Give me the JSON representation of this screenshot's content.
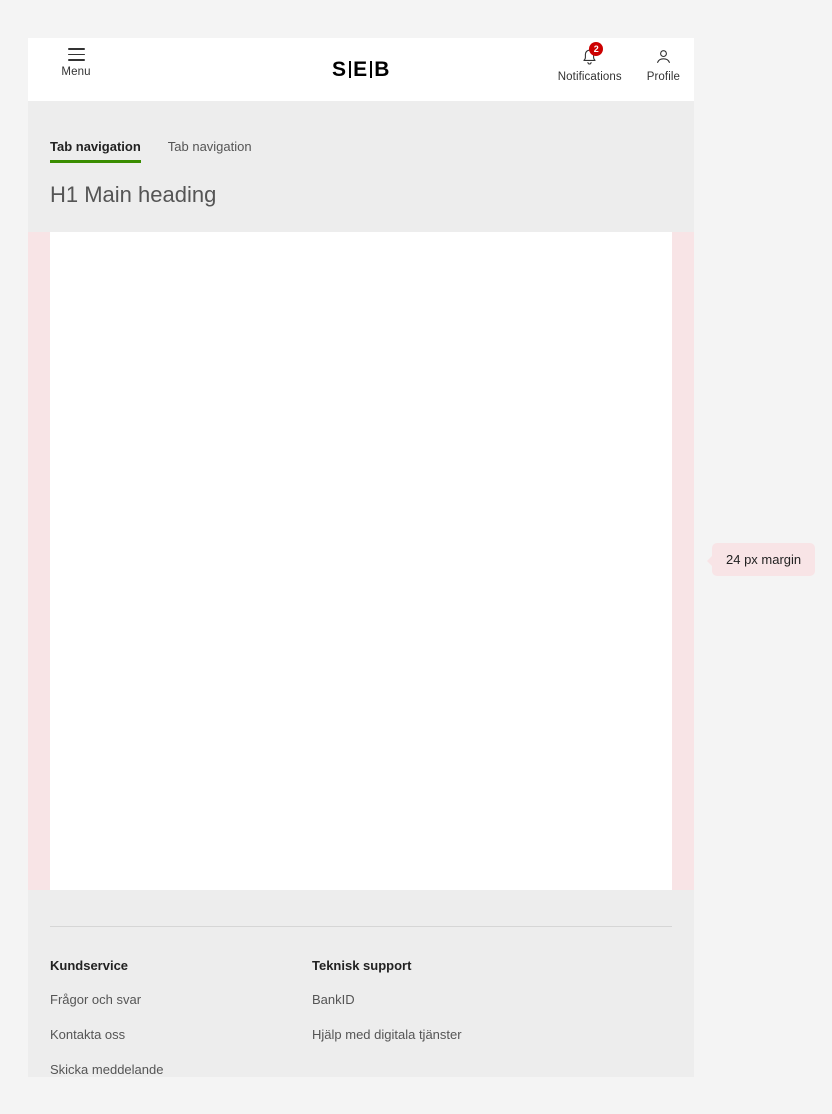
{
  "header": {
    "menu": {
      "label": "Menu",
      "icon": "hamburger-menu-icon"
    },
    "logo": {
      "part1": "S",
      "part2": "E",
      "part3": "B",
      "alt": "SEB"
    },
    "notifications": {
      "label": "Notifications",
      "icon": "bell-icon",
      "badge_count": "2",
      "badge_color": "#cc0000"
    },
    "profile": {
      "label": "Profile",
      "icon": "person-icon"
    }
  },
  "tabs": [
    {
      "label": "Tab navigation",
      "active": true
    },
    {
      "label": "Tab navigation",
      "active": false
    }
  ],
  "main": {
    "heading": "H1 Main heading"
  },
  "annotation": {
    "margin_callout": "24 px margin"
  },
  "footer": {
    "columns": [
      {
        "title": "Kundservice",
        "links": [
          "Frågor och svar",
          "Kontakta oss",
          "Skicka meddelande"
        ]
      },
      {
        "title": "Teknisk support",
        "links": [
          "BankID",
          "Hjälp med digitala tjänster"
        ]
      }
    ]
  },
  "colors": {
    "accent_green": "#3a8d00",
    "badge_red": "#cc0000",
    "margin_guide_pink": "#f8e4e6",
    "page_background": "#f4f4f4",
    "container_background": "#ededed"
  }
}
